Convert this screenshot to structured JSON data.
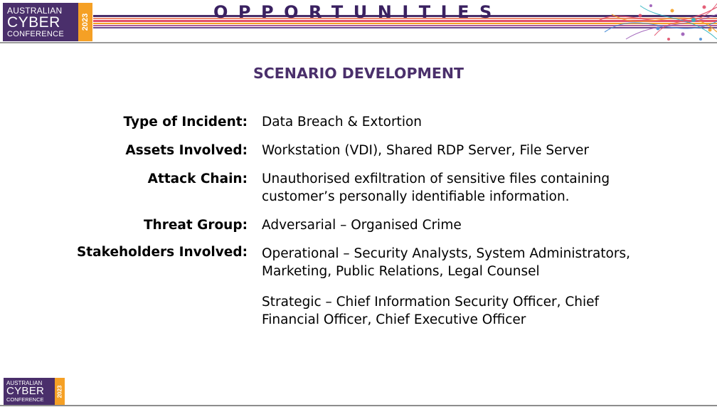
{
  "header": {
    "logo": {
      "line1": "AUSTRALIAN",
      "line2": "CYBER",
      "line3": "CONFERENCE",
      "year": "2023"
    },
    "title": "OPPORTUNITIES"
  },
  "main": {
    "heading": "SCENARIO DEVELOPMENT",
    "details": [
      {
        "label": "Type of Incident:",
        "lines": [
          "Data Breach & Extortion"
        ]
      },
      {
        "label": "Assets Involved:",
        "lines": [
          "Workstation (VDI), Shared RDP Server, File Server"
        ]
      },
      {
        "label": "Attack Chain:",
        "lines": [
          "Unauthorised exfiltration of sensitive files containing",
          "customer’s personally identifiable information."
        ]
      },
      {
        "label": "Threat Group:",
        "lines": [
          "Adversarial – Organised Crime"
        ]
      },
      {
        "label": "Stakeholders Involved:",
        "lines": [
          "Operational – Security Analysts, System Administrators,",
          "Marketing, Public Relations, Legal Counsel"
        ],
        "extra_lines": [
          "Strategic – Chief Information Security Officer, Chief",
          "Financial Officer, Chief Executive Officer"
        ]
      }
    ]
  },
  "footer": {
    "logo": {
      "line1": "AUSTRALIAN",
      "line2": "CYBER",
      "line3": "CONFERENCE",
      "year": "2023"
    }
  },
  "colors": {
    "brand_purple": "#4a2f6b",
    "brand_orange": "#f5a025",
    "title_purple": "#3a2161"
  }
}
